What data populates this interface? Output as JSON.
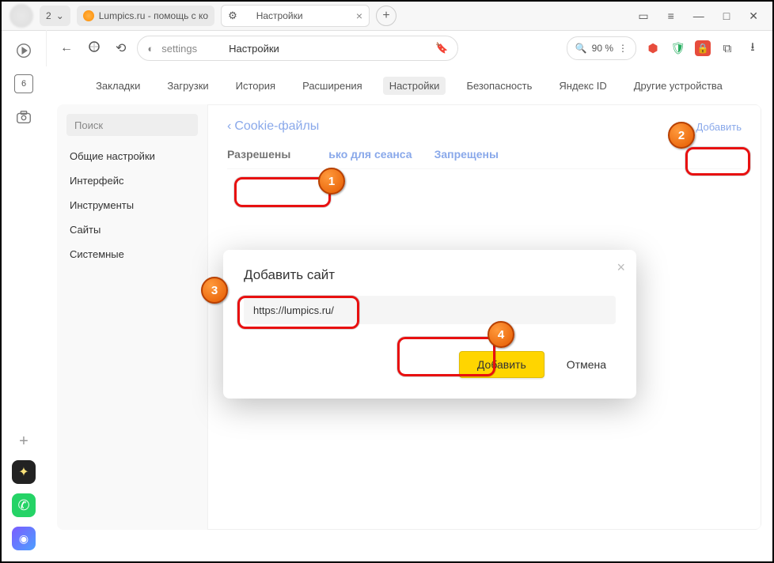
{
  "titlebar": {
    "tab_count": "2",
    "tab1": "Lumpics.ru - помощь с ко",
    "tab2": "Настройки"
  },
  "leftbar": {
    "box": "6"
  },
  "urlbar": {
    "path": "settings",
    "title": "Настройки",
    "zoom": "90 %"
  },
  "topnav": [
    "Закладки",
    "Загрузки",
    "История",
    "Расширения",
    "Настройки",
    "Безопасность",
    "Яндекс ID",
    "Другие устройства"
  ],
  "sidebar": {
    "search": "Поиск",
    "items": [
      "Общие настройки",
      "Интерфейс",
      "Инструменты",
      "Сайты",
      "Системные"
    ]
  },
  "main": {
    "heading": "Cookie-файлы",
    "add_link": "Добавить",
    "filters": [
      "Разрешены",
      "ько для сеанса",
      "Запрещены"
    ]
  },
  "modal": {
    "title": "Добавить сайт",
    "input_value": "https://lumpics.ru/",
    "add_btn": "Добавить",
    "cancel_btn": "Отмена"
  },
  "badges": [
    "1",
    "2",
    "3",
    "4"
  ]
}
